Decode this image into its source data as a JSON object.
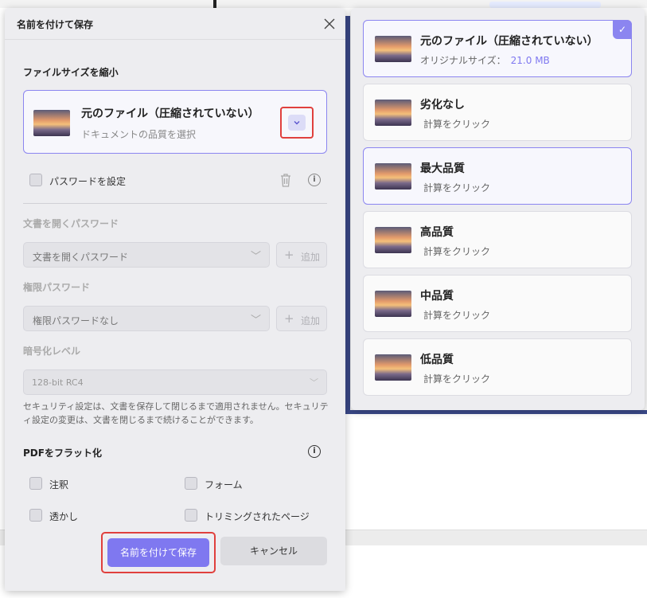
{
  "dialog": {
    "title": "名前を付けて保存",
    "reduce_size_label": "ファイルサイズを縮小",
    "quality_card": {
      "title": "元のファイル（圧縮されていない）",
      "subtitle": "ドキュメントの品質を選択"
    },
    "password_checkbox_label": "パスワードを設定",
    "open_password_label": "文書を開くパスワード",
    "open_password_select": "文書を開くパスワード",
    "permission_password_label": "権限パスワード",
    "permission_password_select": "権限パスワードなし",
    "add_label": "追加",
    "encryption_label": "暗号化レベル",
    "encryption_value": "128-bit RC4",
    "security_note": "セキュリティ設定は、文書を保存して閉じるまで適用されません。セキュリティ設定の変更は、文書を閉じるまで続けることができます。",
    "flatten_label": "PDFをフラット化",
    "flatten_options": [
      "注釈",
      "フォーム",
      "透かし",
      "トリミングされたページ"
    ],
    "save_button": "名前を付けて保存",
    "cancel_button": "キャンセル"
  },
  "quality_panel": {
    "options": [
      {
        "title": "元のファイル（圧縮されていない）",
        "sub_label": "オリジナルサイズ：",
        "size": "21.0 MB",
        "selected": true
      },
      {
        "title": "劣化なし",
        "sub_label": "計算をクリック"
      },
      {
        "title": "最大品質",
        "sub_label": "計算をクリック"
      },
      {
        "title": "高品質",
        "sub_label": "計算をクリック"
      },
      {
        "title": "中品質",
        "sub_label": "計算をクリック"
      },
      {
        "title": "低品質",
        "sub_label": "計算をクリック"
      }
    ]
  },
  "colors": {
    "accent": "#7f78f0",
    "highlight_frame": "#e0403d",
    "dialog_bg": "#ededf0"
  },
  "icons": [
    "close-icon",
    "chevron-down-icon",
    "trash-icon",
    "info-icon",
    "check-icon",
    "plus-icon"
  ]
}
